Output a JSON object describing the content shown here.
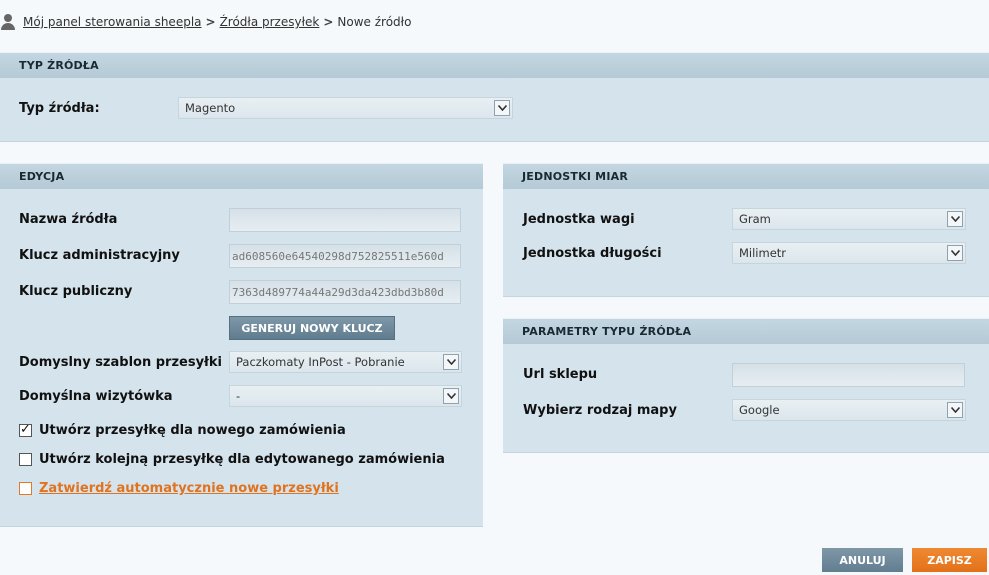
{
  "breadcrumb": {
    "items": [
      "Mój panel sterowania sheepla",
      "Źródła przesyłek"
    ],
    "current": "Nowe źródło"
  },
  "source_type": {
    "header": "TYP ŹRÓDŁA",
    "label": "Typ źródła:",
    "value": "Magento"
  },
  "edit": {
    "header": "EDYCJA",
    "name_label": "Nazwa źródła",
    "name_value": "",
    "admin_key_label": "Klucz administracyjny",
    "admin_key_value": "ad608560e64540298d752825511e560d",
    "public_key_label": "Klucz publiczny",
    "public_key_value": "7363d489774a44a29d3da423dbd3b80d",
    "generate_button": "GENERUJ NOWY KLUCZ",
    "template_label": "Domyslny szablon przesyłki",
    "template_value": "Paczkomaty InPost - Pobranie",
    "card_label": "Domyślna wizytówka",
    "card_value": "-",
    "check1": "Utwórz przesyłkę dla nowego zamówienia",
    "check2": "Utwórz kolejną przesyłkę dla edytowanego zamówienia",
    "check3": "Zatwierdź automatycznie nowe przesyłki"
  },
  "units": {
    "header": "JEDNOSTKI MIAR",
    "weight_label": "Jednostka wagi",
    "weight_value": "Gram",
    "length_label": "Jednostka długości",
    "length_value": "Milimetr"
  },
  "params": {
    "header": "PARAMETRY TYPU ŹRÓDŁA",
    "url_label": "Url sklepu",
    "url_value": "",
    "map_label": "Wybierz rodzaj mapy",
    "map_value": "Google"
  },
  "actions": {
    "cancel": "ANULUJ",
    "save": "ZAPISZ"
  },
  "colors": {
    "accent": "#e27119",
    "panel": "#d5e4ec",
    "header": "#b5cad6"
  }
}
